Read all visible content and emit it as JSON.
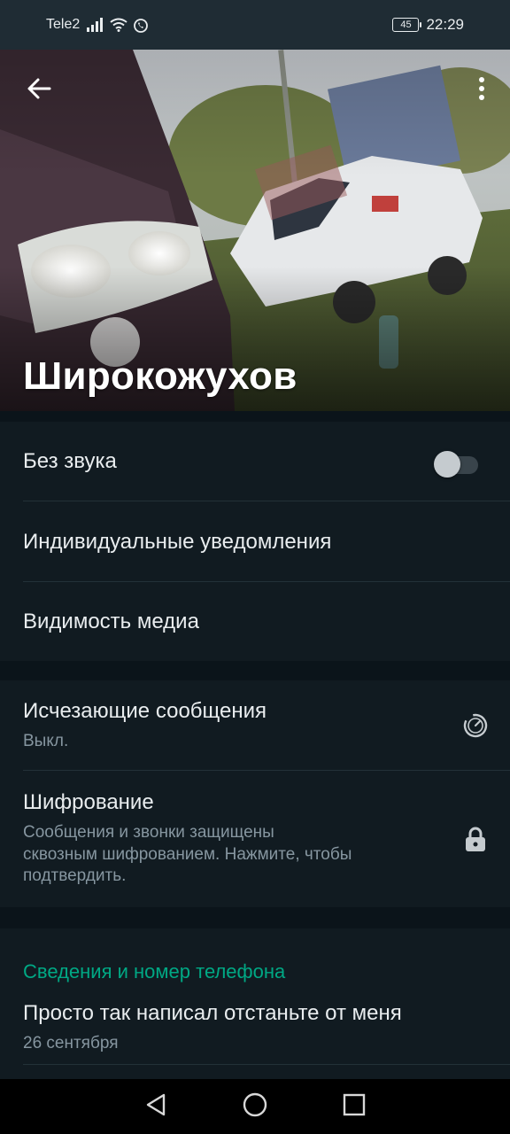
{
  "status_bar": {
    "carrier": "Tele2",
    "battery_level": "45",
    "time": "22:29",
    "icons": [
      "signal-icon",
      "wifi-icon",
      "whatsapp-icon",
      "battery-icon"
    ]
  },
  "header": {
    "contact_name": "Широкожухов",
    "icons": [
      "back-arrow-icon",
      "more-vert-icon"
    ]
  },
  "settings": {
    "mute": {
      "label": "Без звука",
      "enabled": false
    },
    "custom_notifications": {
      "label": "Индивидуальные уведомления"
    },
    "media_visibility": {
      "label": "Видимость медиа"
    }
  },
  "privacy": {
    "disappearing": {
      "label": "Исчезающие сообщения",
      "value": "Выкл.",
      "icon": "timer-icon"
    },
    "encryption": {
      "label": "Шифрование",
      "line1": "Сообщения и звонки защищены",
      "line2": "сквозным шифрованием. Нажмите, чтобы",
      "line3": "подтвердить.",
      "icon": "lock-icon"
    }
  },
  "about": {
    "section_title": "Сведения и номер телефона",
    "status_text": "Просто так написал отстаньте от меня",
    "status_date": "26 сентября"
  },
  "nav_bar": {
    "icons": [
      "nav-back-icon",
      "nav-home-icon",
      "nav-recents-icon"
    ]
  },
  "colors": {
    "background": "#0b141a",
    "surface": "#111b21",
    "accent": "#00a884",
    "text_primary": "#e9edef",
    "text_secondary": "#8696a0"
  }
}
